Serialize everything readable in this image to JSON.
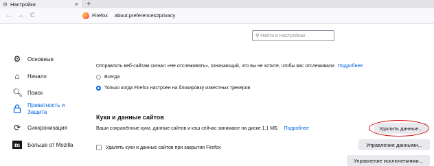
{
  "tab": {
    "title": "Настройки",
    "icon": "gear-icon",
    "close": "×",
    "new_tab": "+"
  },
  "nav": {
    "back": "←",
    "forward": "→",
    "reload": "C"
  },
  "urlbar": {
    "brand": "Firefox",
    "url": "about:preferences#privacy"
  },
  "search": {
    "placeholder": "Найти в Настройках",
    "icon": "search-icon"
  },
  "sidebar": {
    "items": [
      {
        "label": "Основные",
        "icon": "gear-icon"
      },
      {
        "label": "Начало",
        "icon": "home-icon"
      },
      {
        "label": "Поиск",
        "icon": "search-icon"
      },
      {
        "label_line1": "Приватность и",
        "label_line2": "Защита",
        "icon": "lock-icon",
        "active": true
      },
      {
        "label": "Синхронизация",
        "icon": "sync-icon"
      },
      {
        "label": "Больше от Mozilla",
        "icon": "mozilla-icon"
      }
    ]
  },
  "dnt": {
    "text": "Отправлять веб-сайтам сигнал «Не отслеживать», означающий, что вы не хотите, чтобы вас отслеживали",
    "link": "Подробнее",
    "options": [
      {
        "label": "Всегда",
        "checked": false
      },
      {
        "label": "Только когда Firefox настроен на блокировку известных трекеров",
        "checked": true
      }
    ]
  },
  "cookies": {
    "title": "Куки и данные сайтов",
    "usage_text": "Ваши сохранённые куки, данные сайтов и кэш сейчас занимают на диске 1,1 МБ.",
    "link": "Подробнее",
    "delete_on_close": "Удалять куки и данные сайтов при закрытии Firefox",
    "buttons": {
      "clear": "Удалить данные...",
      "manage": "Управление данными...",
      "exceptions": "Управление исключениями..."
    }
  },
  "colors": {
    "accent": "#0061e0",
    "annotation": "#d20f0f"
  }
}
